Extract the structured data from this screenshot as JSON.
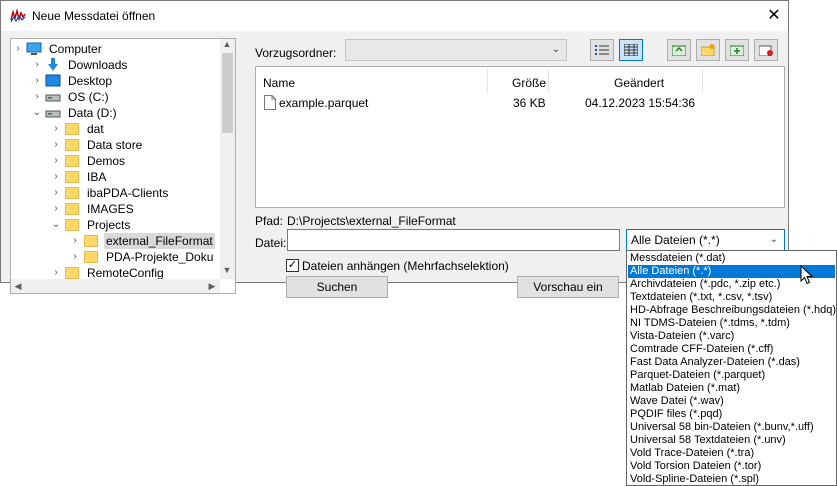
{
  "window": {
    "title": "Neue Messdatei öffnen",
    "close_glyph": "✕"
  },
  "tree": {
    "items": [
      {
        "label": "Computer",
        "icon": "computer-icon",
        "chevron": "›",
        "indent": 0
      },
      {
        "label": "Downloads",
        "icon": "download-arrow-icon",
        "chevron": "›",
        "indent": 1
      },
      {
        "label": "Desktop",
        "icon": "desktop-icon",
        "chevron": "›",
        "indent": 1
      },
      {
        "label": "OS (C:)",
        "icon": "drive-icon",
        "chevron": "›",
        "indent": 1
      },
      {
        "label": "Data (D:)",
        "icon": "drive-icon",
        "chevron": "⌄",
        "indent": 1
      },
      {
        "label": "dat",
        "icon": "folder-icon",
        "chevron": "›",
        "indent": 2
      },
      {
        "label": "Data store",
        "icon": "folder-icon",
        "chevron": "›",
        "indent": 2
      },
      {
        "label": "Demos",
        "icon": "folder-icon",
        "chevron": "›",
        "indent": 2
      },
      {
        "label": "IBA",
        "icon": "folder-icon",
        "chevron": "›",
        "indent": 2
      },
      {
        "label": "ibaPDA-Clients",
        "icon": "folder-icon",
        "chevron": "›",
        "indent": 2
      },
      {
        "label": "IMAGES",
        "icon": "folder-icon",
        "chevron": "›",
        "indent": 2
      },
      {
        "label": "Projects",
        "icon": "folder-icon",
        "chevron": "⌄",
        "indent": 2
      },
      {
        "label": "external_FileFormat",
        "icon": "folder-icon",
        "chevron": "›",
        "indent": 3,
        "selected": true
      },
      {
        "label": "PDA-Projekte_Doku",
        "icon": "folder-icon",
        "chevron": "›",
        "indent": 3
      },
      {
        "label": "RemoteConfig",
        "icon": "folder-icon",
        "chevron": "›",
        "indent": 2
      }
    ]
  },
  "favorites": {
    "label": "Vorzugsordner:",
    "value": ""
  },
  "files": {
    "headers": {
      "name": "Name",
      "size": "Größe",
      "modified": "Geändert"
    },
    "rows": [
      {
        "name": "example.parquet",
        "size": "36 KB",
        "modified": "04.12.2023 15:54:36"
      }
    ]
  },
  "path": {
    "label": "Pfad:",
    "value": "D:\\Projects\\external_FileFormat"
  },
  "file_input": {
    "label": "Datei:",
    "value": ""
  },
  "filter": {
    "value": "Alle Dateien (*.*)"
  },
  "append": {
    "label": "Dateien anhängen (Mehrfachselektion)",
    "checked": true
  },
  "buttons": {
    "search": "Suchen",
    "preview": "Vorschau ein"
  },
  "dropdown_options": [
    "Messdateien (*.dat)",
    "Alle Dateien (*.*)",
    "Archivdateien (*.pdc, *.zip etc.)",
    "Textdateien (*.txt, *.csv, *.tsv)",
    "HD-Abfrage Beschreibungsdateien (*.hdq)",
    "NI TDMS-Dateien (*.tdms, *.tdm)",
    "Vista-Dateien (*.varc)",
    "Comtrade CFF-Dateien (*.cff)",
    "Fast Data Analyzer-Dateien (*.das)",
    "Parquet-Dateien (*.parquet)",
    "Matlab Dateien (*.mat)",
    "Wave Datei (*.wav)",
    "PQDIF files (*.pqd)",
    "Universal 58 bin-Dateien (*.bunv,*.uff)",
    "Universal 58 Textdateien (*.unv)",
    "Vold Trace-Dateien (*.tra)",
    "Vold Torsion Dateien (*.tor)",
    "Vold-Spline-Dateien (*.spl)"
  ],
  "dropdown_selected": 1,
  "colors": {
    "selection": "#0078d7",
    "folder": "#ffd86b",
    "dialog_bg": "#f0f0f0"
  }
}
